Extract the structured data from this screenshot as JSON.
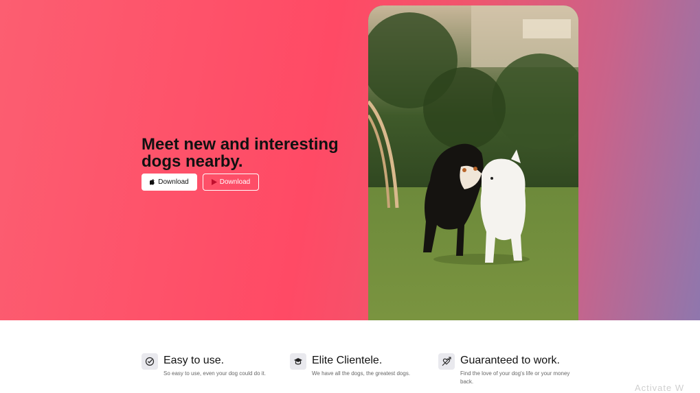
{
  "hero": {
    "title": "Meet new and interesting dogs nearby.",
    "apple_button_label": "Download",
    "play_button_label": "Download",
    "image_alt": "Two dogs playing in a park"
  },
  "features": [
    {
      "icon": "check-circle-icon",
      "title": "Easy to use.",
      "description": "So easy to use, even your dog could do it."
    },
    {
      "icon": "graduation-cap-icon",
      "title": "Elite Clientele.",
      "description": "We have all the dogs, the greatest dogs."
    },
    {
      "icon": "heart-arrow-icon",
      "title": "Guaranteed to work.",
      "description": "Find the love of your dog's life or your money back."
    }
  ],
  "colors": {
    "hero_pink": "#ff4a65",
    "hero_purple": "#8f77ad",
    "white": "#ffffff"
  },
  "watermark": "Activate W"
}
